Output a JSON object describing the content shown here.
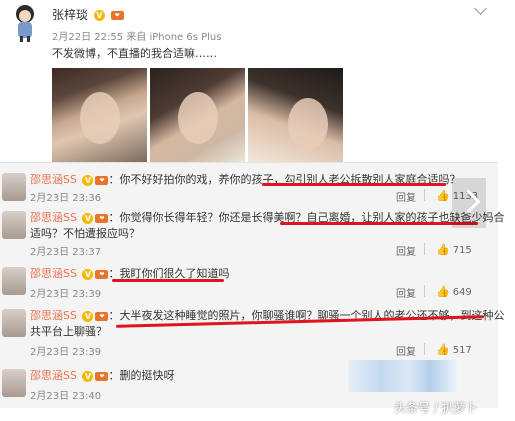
{
  "post": {
    "username": "张梓琰",
    "meta": "2月22日 22:55 来自 iPhone 6s Plus",
    "text": "不发微博，不直播的我合适嘛……",
    "v_badge": "V"
  },
  "comments": [
    {
      "user": "邵思涵SS",
      "text": "你不好好拍你的戏，养你的孩子，勾引别人老公拆散别人家庭合适吗？",
      "time": "2月23日 23:36",
      "reply": "回复",
      "likes": "1133"
    },
    {
      "user": "邵思涵SS",
      "text": "你觉得你长得年轻？你还是长得美啊？自己离婚，让别人家的孩子也缺爸少妈合",
      "text2": "适吗？不怕遭报应吗？",
      "time": "2月23日 23:37",
      "reply": "回复",
      "likes": "715"
    },
    {
      "user": "邵思涵SS",
      "text": "我盯你们很久了知道吗",
      "time": "2月23日 23:39",
      "reply": "回复",
      "likes": "649"
    },
    {
      "user": "邵思涵SS",
      "text": "大半夜发这种睡觉的照片，你聊骚谁啊？聊骚一个别人的老公还不够，到这种公",
      "text2": "共平台上聊骚？",
      "time": "2月23日 23:39",
      "reply": "回复",
      "likes": "517"
    },
    {
      "user": "邵思涵SS",
      "text": "删的挺快呀",
      "time": "2月23日 23:40"
    }
  ],
  "watermark": "头条号 / 扒萝卜",
  "colors": {
    "username": "#eb7350",
    "highlight": "#e0141e"
  }
}
